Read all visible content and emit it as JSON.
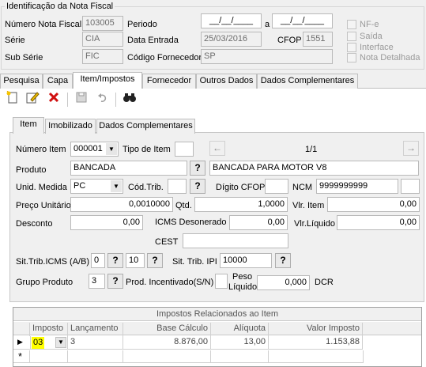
{
  "header": {
    "group_title": "Identificação da Nota Fiscal",
    "numero_label": "Número Nota Fiscal",
    "numero_value": "103005",
    "periodo_label": "Periodo",
    "periodo_from": "__/__/____",
    "periodo_sep": "a",
    "periodo_to": "__/__/____",
    "serie_label": "Série",
    "serie_value": "CIA",
    "data_entrada_label": "Data Entrada",
    "data_entrada_value": "25/03/2016",
    "cfop_label": "CFOP",
    "cfop_value": "1551",
    "subserie_label": "Sub Série",
    "subserie_value": "FIC",
    "fornecedor_label": "Código Fornecedor",
    "fornecedor_value": "SP",
    "checks": [
      "NF-e",
      "Saída",
      "Interface",
      "Nota Detalhada"
    ]
  },
  "main_tabs": [
    "Pesquisa",
    "Capa",
    "Item/Impostos",
    "Fornecedor",
    "Outros Dados",
    "Dados Complementares"
  ],
  "toolbar_icons": [
    "new-icon",
    "edit-icon",
    "delete-icon",
    "save-icon",
    "undo-icon",
    "search-binoculars-icon"
  ],
  "sub_tabs": [
    "Item",
    "Imobilizado",
    "Dados Complementares"
  ],
  "item": {
    "numero_item_label": "Número Item",
    "numero_item_value": "000001",
    "tipo_item_label": "Tipo de Item",
    "tipo_item_value": "",
    "nav_prev": "←",
    "nav_next": "→",
    "position": "1/1",
    "produto_label": "Produto",
    "produto_code": "BANCADA",
    "produto_desc": "BANCADA PARA MOTOR V8",
    "lookup_label": "?",
    "unid_label": "Unid. Medida",
    "unid_value": "PC",
    "codtrib_label": "Cód.Trib.",
    "codtrib_value": "",
    "digito_cfop_label": "Dígito CFOP",
    "digito_cfop_value": "",
    "ncm_label": "NCM",
    "ncm_value": "9999999999",
    "ncm_extra": "",
    "preco_label": "Preço Unitário",
    "preco_value": "0,0010000",
    "qtd_label": "Qtd.",
    "qtd_value": "1,0000",
    "vlr_item_label": "Vlr. Item",
    "vlr_item_value": "0,00",
    "desconto_label": "Desconto",
    "desconto_value": "0,00",
    "icms_deson_label": "ICMS Desonerado",
    "icms_deson_value": "0,00",
    "vlr_liquido_label": "Vlr.Líquido",
    "vlr_liquido_value": "0,00",
    "cest_label": "CEST",
    "cest_value": "",
    "sit_icms_label": "Sit.Trib.ICMS (A/B)",
    "sit_icms_a": "0",
    "sit_icms_b": "10",
    "sit_ipi_label": "Sit. Trib. IPI",
    "sit_ipi_value": "10000",
    "grupo_label": "Grupo Produto",
    "grupo_value": "3",
    "prod_incent_label": "Prod. Incentivado(S/N)",
    "prod_incent_value": "",
    "peso_label_1": "Peso",
    "peso_label_2": "Líquido",
    "peso_value": "0,000",
    "dcr_label": "DCR"
  },
  "grid": {
    "title": "Impostos Relacionados ao Item",
    "columns": [
      "Imposto",
      "Lançamento",
      "Base Cálculo",
      "Alíquota",
      "Valor Imposto"
    ],
    "rows": [
      {
        "imposto": "03",
        "lancamento": "3",
        "base": "8.876,00",
        "aliquota": "13,00",
        "valor": "1.153,88"
      }
    ],
    "new_row_marker": "*"
  }
}
